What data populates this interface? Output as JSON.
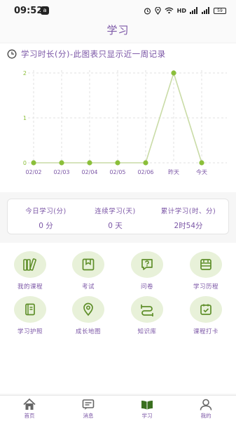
{
  "status_bar": {
    "time": "09:52",
    "app_badge": "a",
    "network": "HD",
    "battery": "59"
  },
  "header": {
    "title": "学习"
  },
  "chart_section": {
    "title": "学习时长(分)-此图表只显示近一周记录"
  },
  "chart_data": {
    "type": "line",
    "categories": [
      "02/02",
      "02/03",
      "02/04",
      "02/05",
      "02/06",
      "昨天",
      "今天"
    ],
    "values": [
      0,
      0,
      0,
      0,
      0,
      2,
      0
    ],
    "yticks": [
      "0",
      "1",
      "2"
    ],
    "ylim": [
      0,
      2
    ],
    "grid": true,
    "color": "#8bbf3a"
  },
  "stats": [
    {
      "label": "今日学习(分)",
      "value": "0 分"
    },
    {
      "label": "连续学习(天)",
      "value": "0 天"
    },
    {
      "label": "累计学习(时、分)",
      "value": "2时54分"
    }
  ],
  "features": [
    {
      "label": "我的课程",
      "icon": "books-icon"
    },
    {
      "label": "考试",
      "icon": "exam-icon"
    },
    {
      "label": "问卷",
      "icon": "question-icon"
    },
    {
      "label": "学习历程",
      "icon": "history-icon"
    },
    {
      "label": "学习护照",
      "icon": "passport-icon"
    },
    {
      "label": "成长地图",
      "icon": "map-pin-icon"
    },
    {
      "label": "知识库",
      "icon": "knowledge-icon"
    },
    {
      "label": "课程打卡",
      "icon": "checkin-icon"
    }
  ],
  "tabs": [
    {
      "label": "首页",
      "icon": "home-icon"
    },
    {
      "label": "消息",
      "icon": "message-icon"
    },
    {
      "label": "学习",
      "icon": "study-icon",
      "active": true
    },
    {
      "label": "我的",
      "icon": "user-icon"
    }
  ],
  "colors": {
    "accent": "#7b56a6",
    "green": "#8bbf3a",
    "tile_bg": "#e8f1d9",
    "icon_green": "#5f8f2a"
  }
}
